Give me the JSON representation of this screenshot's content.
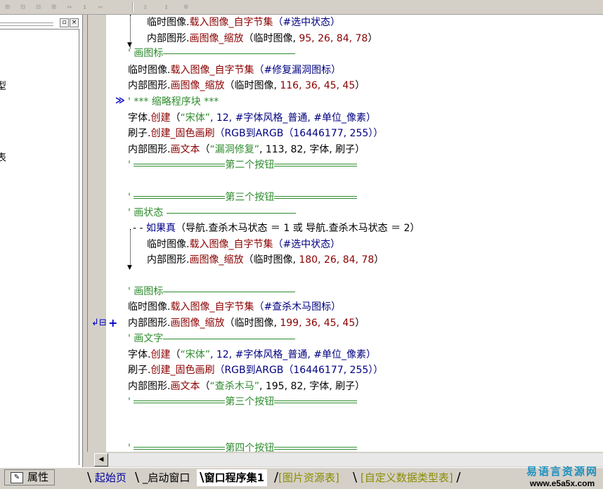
{
  "toolbar": {
    "buttons": [
      {
        "icon": "align-left-icon",
        "glyph": "⊞"
      },
      {
        "icon": "align-center-icon",
        "glyph": "⊟"
      },
      {
        "icon": "align-right-icon",
        "glyph": "⊟"
      },
      {
        "icon": "align-top-icon",
        "glyph": "⊞"
      },
      {
        "icon": "same-width-icon",
        "glyph": "↔"
      },
      {
        "icon": "same-height-icon",
        "glyph": "↕"
      },
      {
        "icon": "h-space-icon",
        "glyph": "⇔"
      },
      {
        "icon": "v-space-icon",
        "glyph": "⇕"
      },
      {
        "icon": "center-icon",
        "glyph": "⊕"
      }
    ]
  },
  "left_panel": {
    "pin_label": "▫",
    "close_label": "×",
    "fragments": [
      "型",
      "表"
    ]
  },
  "code_lines": [
    {
      "text_a": "临时图像.",
      "text_b": "载入图像_自字节集",
      "text_c": "（#选中状态）"
    },
    {
      "text_a": "内部图形.",
      "text_b": "画图像_缩放",
      "text_c": "（临时图像, ",
      "nums": "95, 26, 84, 78",
      "tail": "）"
    },
    {
      "comment": "' 画图标"
    },
    {
      "text_a": "临时图像.",
      "text_b": "载入图像_自字节集",
      "text_c": "（#修复漏洞图标）"
    },
    {
      "text_a": "内部图形.",
      "text_b": "画图像_缩放",
      "text_c": "（临时图像, ",
      "nums": "116, 36, 45, 45",
      "tail": "）"
    },
    {
      "comment": "' *** 缩略程序块 ***"
    },
    {
      "text_a": "字体.",
      "text_b": "创建",
      "text_c": "（",
      "str": "“宋体”",
      "rest": ", 12, #字体风格_普通, #单位_像素）"
    },
    {
      "text_a": "刷子.",
      "text_b": "创建_固色画刷",
      "text_c": "（RGB到ARGB（16446177, 255））"
    },
    {
      "text_a": "内部图形.",
      "text_b": "画文本",
      "text_c": "（",
      "str": "“漏洞修复”",
      "rest": ", 113, 82, 字体, 刷子）"
    },
    {
      "comment": "' ═══════════第二个按钮═══════════"
    },
    {
      "comment": "' ═══════════第三个按钮═══════════"
    },
    {
      "comment": "' 画状态"
    },
    {
      "if_text": "如果真",
      "cond": "（导航.查杀木马状态 ＝ 1 或 导航.查杀木马状态 ＝ 2）"
    },
    {
      "text_a": "临时图像.",
      "text_b": "载入图像_自字节集",
      "text_c": "（#选中状态）"
    },
    {
      "text_a": "内部图形.",
      "text_b": "画图像_缩放",
      "text_c": "（临时图像, ",
      "nums": "180, 26, 84, 78",
      "tail": "）"
    },
    {
      "comment": "' 画图标"
    },
    {
      "text_a": "临时图像.",
      "text_b": "载入图像_自字节集",
      "text_c": "（#查杀木马图标）"
    },
    {
      "text_a": "内部图形.",
      "text_b": "画图像_缩放",
      "text_c": "（临时图像, ",
      "nums": "199, 36, 45, 45",
      "tail": "）"
    },
    {
      "comment": "' 画文字"
    },
    {
      "text_a": "字体.",
      "text_b": "创建",
      "text_c": "（",
      "str": "“宋体”",
      "rest": ", 12, #字体风格_普通, #单位_像素）"
    },
    {
      "text_a": "刷子.",
      "text_b": "创建_固色画刷",
      "text_c": "（RGB到ARGB（16446177, 255））"
    },
    {
      "text_a": "内部图形.",
      "text_b": "画文本",
      "text_c": "（",
      "str": "“查杀木马”",
      "rest": ", 195, 82, 字体, 刷子）"
    },
    {
      "comment": "' ═══════════第三个按钮═══════════"
    },
    {
      "comment": "' ═══════════第四个按钮═══════════"
    }
  ],
  "texts": {
    "c_draw_icon": "画图标",
    "c_fold": "*** 缩略程序块 ***",
    "c_btn2": "第二个按钮",
    "c_btn3": "第三个按钮",
    "c_state": "画状态",
    "c_text": "画文字",
    "c_btn4": "第四个按钮",
    "quote": "'",
    "if_kw": "如果真",
    "if_cond": "（导航.查杀木马状态 ＝ 1 或 导航.查杀木马状态 ＝ 2）",
    "tmp": "临时图像",
    "inner": "内部图形",
    "font": "字体",
    "brush": "刷子",
    "load": "载入图像_自字节集",
    "draw_scaled": "画图像_缩放",
    "create": "创建",
    "create_brush": "创建_固色画刷",
    "draw_text": "画文本",
    "arg_selected": "（#选中状态）",
    "arg_repair_icon": "（#修复漏洞图标）",
    "arg_trojan_icon": "（#查杀木马图标）",
    "arg_tmp": "（临时图像, ",
    "n1": "95, 26, 84, 78",
    "n2": "116, 36, 45, 45",
    "n3": "180, 26, 84, 78",
    "n4": "199, 36, 45, 45",
    "close_paren": "）",
    "open_paren": "（",
    "songti": "“宋体”",
    "font_rest": ", 12, #字体风格_普通, #单位_像素）",
    "rgb": "（RGB到ARGB（16446177, 255））",
    "str_repair": "“漏洞修复”",
    "str_trojan": "“查杀木马”",
    "text_rest1": ", 113, 82, 字体, 刷子）",
    "text_rest2": ", 195, 82, 字体, 刷子）"
  },
  "gutter": {
    "fold_marker": "≫",
    "plus_marker": "+",
    "cursor_marker": "↲⊟"
  },
  "status": {
    "properties_label": "属性",
    "tabs": [
      "起始页",
      "_启动窗口",
      "窗口程序集1",
      "[图片资源表]",
      "[自定义数据类型表]"
    ],
    "active_tab": "窗口程序集1"
  },
  "watermark": {
    "line1": "易语言资源网",
    "line2": "www.e5a5x.com"
  }
}
